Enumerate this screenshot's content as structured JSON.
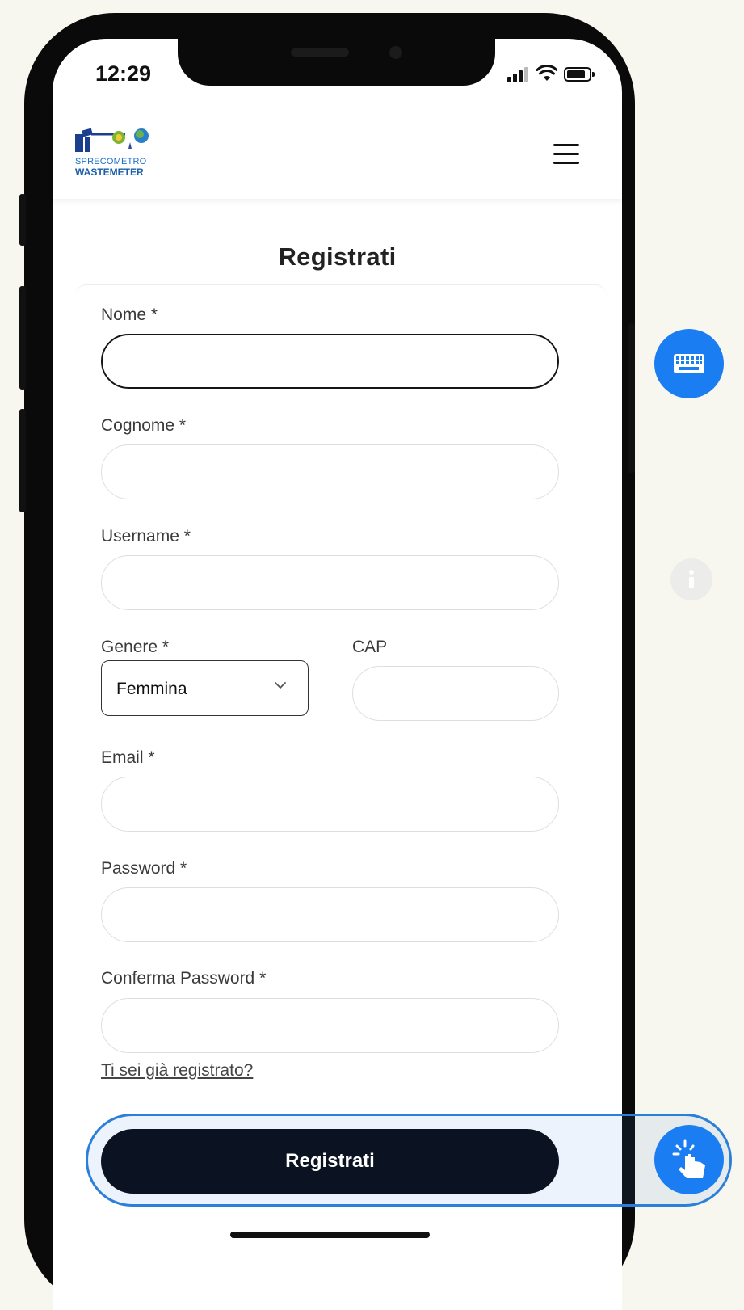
{
  "status_bar": {
    "time": "12:29"
  },
  "header": {
    "logo_line1": "SPRECOMETRO",
    "logo_line2": "WASTEMETER"
  },
  "page_title": "Registrati",
  "form": {
    "nome_label": "Nome *",
    "nome_value": "",
    "cognome_label": "Cognome *",
    "cognome_value": "",
    "username_label": "Username *",
    "username_value": "",
    "genere_label": "Genere *",
    "genere_value": "Femmina",
    "cap_label": "CAP",
    "cap_value": "",
    "email_label": "Email *",
    "email_value": "",
    "password_label": "Password *",
    "password_value": "",
    "conferma_label": "Conferma Password *",
    "conferma_value": "",
    "login_link": "Ti sei già registrato?",
    "submit_label": "Registrati"
  },
  "colors": {
    "accent_blue": "#1a7ef2",
    "submit_bg": "#0b1222",
    "page_bg": "#f8f7ef"
  },
  "icons": [
    "keyboard-icon",
    "info-icon",
    "tap-icon",
    "hamburger-menu-icon",
    "chevron-down-icon",
    "signal-icon",
    "wifi-icon",
    "battery-icon"
  ]
}
